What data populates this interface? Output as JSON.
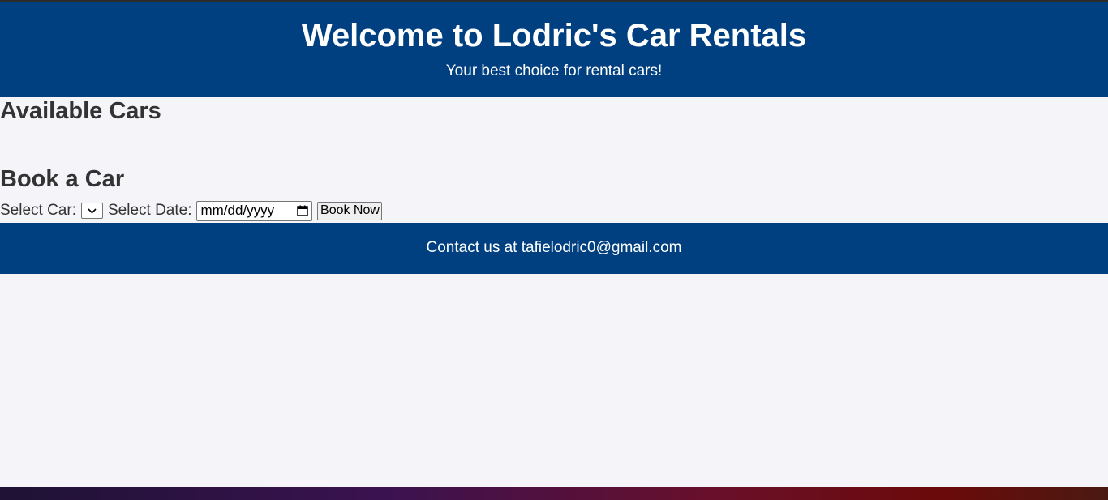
{
  "header": {
    "title": "Welcome to Lodric's Car Rentals",
    "subtitle": "Your best choice for rental cars!"
  },
  "cars_section": {
    "title": "Available Cars"
  },
  "booking": {
    "title": "Book a Car",
    "car_label": "Select Car:",
    "date_label": "Select Date:",
    "date_placeholder": "mm/dd/yyyy",
    "book_button": "Book Now"
  },
  "footer": {
    "contact": "Contact us at tafielodric0@gmail.com"
  },
  "colors": {
    "brand": "#004080",
    "background": "#f4f4f9"
  },
  "icons": {
    "select_arrow": "chevron-down-icon",
    "date_picker": "calendar-icon"
  }
}
